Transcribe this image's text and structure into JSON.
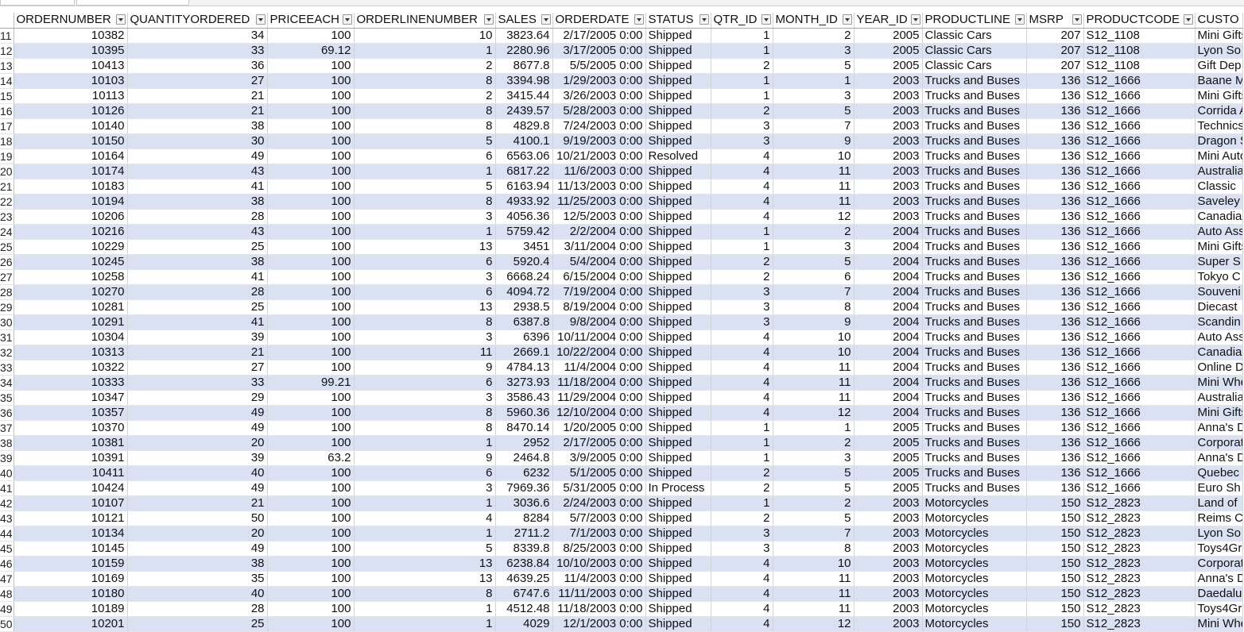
{
  "columns": [
    "ORDERNUMBER",
    "QUANTITYORDERED",
    "PRICEEACH",
    "ORDERLINENUMBER",
    "SALES",
    "ORDERDATE",
    "STATUS",
    "QTR_ID",
    "MONTH_ID",
    "YEAR_ID",
    "PRODUCTLINE",
    "MSRP",
    "PRODUCTCODE",
    "CUSTO"
  ],
  "column_align": [
    "num",
    "num",
    "num",
    "num",
    "num",
    "num",
    "txt",
    "num",
    "num",
    "num",
    "txt",
    "num",
    "txt",
    "txt"
  ],
  "rows": [
    [
      "11",
      "10382",
      "34",
      "100",
      "10",
      "3823.64",
      "2/17/2005 0:00",
      "Shipped",
      "1",
      "2",
      "2005",
      "Classic Cars",
      "207",
      "S12_1108",
      "Mini Gifts"
    ],
    [
      "12",
      "10395",
      "33",
      "69.12",
      "1",
      "2280.96",
      "3/17/2005 0:00",
      "Shipped",
      "1",
      "3",
      "2005",
      "Classic Cars",
      "207",
      "S12_1108",
      "Lyon So"
    ],
    [
      "13",
      "10413",
      "36",
      "100",
      "2",
      "8677.8",
      "5/5/2005 0:00",
      "Shipped",
      "2",
      "5",
      "2005",
      "Classic Cars",
      "207",
      "S12_1108",
      "Gift Dep"
    ],
    [
      "14",
      "10103",
      "27",
      "100",
      "8",
      "3394.98",
      "1/29/2003 0:00",
      "Shipped",
      "1",
      "1",
      "2003",
      "Trucks and Buses",
      "136",
      "S12_1666",
      "Baane M"
    ],
    [
      "15",
      "10113",
      "21",
      "100",
      "2",
      "3415.44",
      "3/26/2003 0:00",
      "Shipped",
      "1",
      "3",
      "2003",
      "Trucks and Buses",
      "136",
      "S12_1666",
      "Mini Gifts"
    ],
    [
      "16",
      "10126",
      "21",
      "100",
      "8",
      "2439.57",
      "5/28/2003 0:00",
      "Shipped",
      "2",
      "5",
      "2003",
      "Trucks and Buses",
      "136",
      "S12_1666",
      "Corrida A"
    ],
    [
      "17",
      "10140",
      "38",
      "100",
      "8",
      "4829.8",
      "7/24/2003 0:00",
      "Shipped",
      "3",
      "7",
      "2003",
      "Trucks and Buses",
      "136",
      "S12_1666",
      "Technics"
    ],
    [
      "18",
      "10150",
      "30",
      "100",
      "5",
      "4100.1",
      "9/19/2003 0:00",
      "Shipped",
      "3",
      "9",
      "2003",
      "Trucks and Buses",
      "136",
      "S12_1666",
      "Dragon S"
    ],
    [
      "19",
      "10164",
      "49",
      "100",
      "6",
      "6563.06",
      "10/21/2003 0:00",
      "Resolved",
      "4",
      "10",
      "2003",
      "Trucks and Buses",
      "136",
      "S12_1666",
      "Mini Auto"
    ],
    [
      "20",
      "10174",
      "43",
      "100",
      "1",
      "6817.22",
      "11/6/2003 0:00",
      "Shipped",
      "4",
      "11",
      "2003",
      "Trucks and Buses",
      "136",
      "S12_1666",
      "Australia"
    ],
    [
      "21",
      "10183",
      "41",
      "100",
      "5",
      "6163.94",
      "11/13/2003 0:00",
      "Shipped",
      "4",
      "11",
      "2003",
      "Trucks and Buses",
      "136",
      "S12_1666",
      "Classic"
    ],
    [
      "22",
      "10194",
      "38",
      "100",
      "8",
      "4933.92",
      "11/25/2003 0:00",
      "Shipped",
      "4",
      "11",
      "2003",
      "Trucks and Buses",
      "136",
      "S12_1666",
      "Saveley"
    ],
    [
      "23",
      "10206",
      "28",
      "100",
      "3",
      "4056.36",
      "12/5/2003 0:00",
      "Shipped",
      "4",
      "12",
      "2003",
      "Trucks and Buses",
      "136",
      "S12_1666",
      "Canadia"
    ],
    [
      "24",
      "10216",
      "43",
      "100",
      "1",
      "5759.42",
      "2/2/2004 0:00",
      "Shipped",
      "1",
      "2",
      "2004",
      "Trucks and Buses",
      "136",
      "S12_1666",
      "Auto Ass"
    ],
    [
      "25",
      "10229",
      "25",
      "100",
      "13",
      "3451",
      "3/11/2004 0:00",
      "Shipped",
      "1",
      "3",
      "2004",
      "Trucks and Buses",
      "136",
      "S12_1666",
      "Mini Gifts"
    ],
    [
      "26",
      "10245",
      "38",
      "100",
      "6",
      "5920.4",
      "5/4/2004 0:00",
      "Shipped",
      "2",
      "5",
      "2004",
      "Trucks and Buses",
      "136",
      "S12_1666",
      "Super S"
    ],
    [
      "27",
      "10258",
      "41",
      "100",
      "3",
      "6668.24",
      "6/15/2004 0:00",
      "Shipped",
      "2",
      "6",
      "2004",
      "Trucks and Buses",
      "136",
      "S12_1666",
      "Tokyo C"
    ],
    [
      "28",
      "10270",
      "28",
      "100",
      "6",
      "4094.72",
      "7/19/2004 0:00",
      "Shipped",
      "3",
      "7",
      "2004",
      "Trucks and Buses",
      "136",
      "S12_1666",
      "Souveni"
    ],
    [
      "29",
      "10281",
      "25",
      "100",
      "13",
      "2938.5",
      "8/19/2004 0:00",
      "Shipped",
      "3",
      "8",
      "2004",
      "Trucks and Buses",
      "136",
      "S12_1666",
      "Diecast"
    ],
    [
      "30",
      "10291",
      "41",
      "100",
      "8",
      "6387.8",
      "9/8/2004 0:00",
      "Shipped",
      "3",
      "9",
      "2004",
      "Trucks and Buses",
      "136",
      "S12_1666",
      "Scandin"
    ],
    [
      "31",
      "10304",
      "39",
      "100",
      "3",
      "6396",
      "10/11/2004 0:00",
      "Shipped",
      "4",
      "10",
      "2004",
      "Trucks and Buses",
      "136",
      "S12_1666",
      "Auto Ass"
    ],
    [
      "32",
      "10313",
      "21",
      "100",
      "11",
      "2669.1",
      "10/22/2004 0:00",
      "Shipped",
      "4",
      "10",
      "2004",
      "Trucks and Buses",
      "136",
      "S12_1666",
      "Canadia"
    ],
    [
      "33",
      "10322",
      "27",
      "100",
      "9",
      "4784.13",
      "11/4/2004 0:00",
      "Shipped",
      "4",
      "11",
      "2004",
      "Trucks and Buses",
      "136",
      "S12_1666",
      "Online D"
    ],
    [
      "34",
      "10333",
      "33",
      "99.21",
      "6",
      "3273.93",
      "11/18/2004 0:00",
      "Shipped",
      "4",
      "11",
      "2004",
      "Trucks and Buses",
      "136",
      "S12_1666",
      "Mini Whe"
    ],
    [
      "35",
      "10347",
      "29",
      "100",
      "3",
      "3586.43",
      "11/29/2004 0:00",
      "Shipped",
      "4",
      "11",
      "2004",
      "Trucks and Buses",
      "136",
      "S12_1666",
      "Australia"
    ],
    [
      "36",
      "10357",
      "49",
      "100",
      "8",
      "5960.36",
      "12/10/2004 0:00",
      "Shipped",
      "4",
      "12",
      "2004",
      "Trucks and Buses",
      "136",
      "S12_1666",
      "Mini Gifts"
    ],
    [
      "37",
      "10370",
      "49",
      "100",
      "8",
      "8470.14",
      "1/20/2005 0:00",
      "Shipped",
      "1",
      "1",
      "2005",
      "Trucks and Buses",
      "136",
      "S12_1666",
      "Anna's D"
    ],
    [
      "38",
      "10381",
      "20",
      "100",
      "1",
      "2952",
      "2/17/2005 0:00",
      "Shipped",
      "1",
      "2",
      "2005",
      "Trucks and Buses",
      "136",
      "S12_1666",
      "Corporat"
    ],
    [
      "39",
      "10391",
      "39",
      "63.2",
      "9",
      "2464.8",
      "3/9/2005 0:00",
      "Shipped",
      "1",
      "3",
      "2005",
      "Trucks and Buses",
      "136",
      "S12_1666",
      "Anna's D"
    ],
    [
      "40",
      "10411",
      "40",
      "100",
      "6",
      "6232",
      "5/1/2005 0:00",
      "Shipped",
      "2",
      "5",
      "2005",
      "Trucks and Buses",
      "136",
      "S12_1666",
      "Quebec"
    ],
    [
      "41",
      "10424",
      "49",
      "100",
      "3",
      "7969.36",
      "5/31/2005 0:00",
      "In Process",
      "2",
      "5",
      "2005",
      "Trucks and Buses",
      "136",
      "S12_1666",
      "Euro Sh"
    ],
    [
      "42",
      "10107",
      "21",
      "100",
      "1",
      "3036.6",
      "2/24/2003 0:00",
      "Shipped",
      "1",
      "2",
      "2003",
      "Motorcycles",
      "150",
      "S12_2823",
      "Land of"
    ],
    [
      "43",
      "10121",
      "50",
      "100",
      "4",
      "8284",
      "5/7/2003 0:00",
      "Shipped",
      "2",
      "5",
      "2003",
      "Motorcycles",
      "150",
      "S12_2823",
      "Reims C"
    ],
    [
      "44",
      "10134",
      "20",
      "100",
      "1",
      "2711.2",
      "7/1/2003 0:00",
      "Shipped",
      "3",
      "7",
      "2003",
      "Motorcycles",
      "150",
      "S12_2823",
      "Lyon So"
    ],
    [
      "45",
      "10145",
      "49",
      "100",
      "5",
      "8339.8",
      "8/25/2003 0:00",
      "Shipped",
      "3",
      "8",
      "2003",
      "Motorcycles",
      "150",
      "S12_2823",
      "Toys4Gr"
    ],
    [
      "46",
      "10159",
      "38",
      "100",
      "13",
      "6238.84",
      "10/10/2003 0:00",
      "Shipped",
      "4",
      "10",
      "2003",
      "Motorcycles",
      "150",
      "S12_2823",
      "Corporat"
    ],
    [
      "47",
      "10169",
      "35",
      "100",
      "13",
      "4639.25",
      "11/4/2003 0:00",
      "Shipped",
      "4",
      "11",
      "2003",
      "Motorcycles",
      "150",
      "S12_2823",
      "Anna's D"
    ],
    [
      "48",
      "10180",
      "40",
      "100",
      "8",
      "6747.6",
      "11/11/2003 0:00",
      "Shipped",
      "4",
      "11",
      "2003",
      "Motorcycles",
      "150",
      "S12_2823",
      "Daedalu"
    ],
    [
      "49",
      "10189",
      "28",
      "100",
      "1",
      "4512.48",
      "11/18/2003 0:00",
      "Shipped",
      "4",
      "11",
      "2003",
      "Motorcycles",
      "150",
      "S12_2823",
      "Toys4Gr"
    ],
    [
      "50",
      "10201",
      "25",
      "100",
      "1",
      "4029",
      "12/1/2003 0:00",
      "Shipped",
      "4",
      "12",
      "2003",
      "Motorcycles",
      "150",
      "S12_2823",
      "Mini Whe"
    ]
  ]
}
